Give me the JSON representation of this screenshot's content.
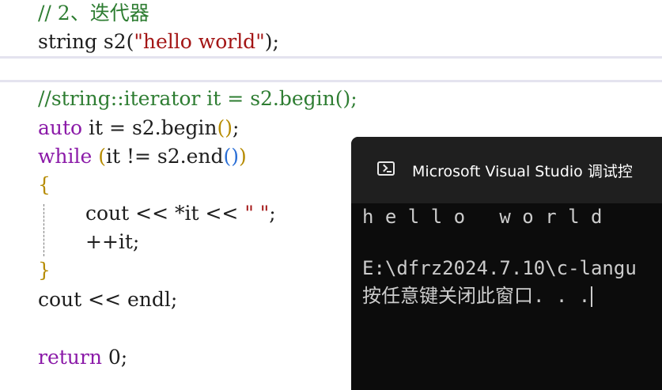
{
  "editor": {
    "line1_comment": "// 2、迭代器",
    "line2": {
      "type": "string",
      "var": "s2",
      "open": "(",
      "literal": "\"hello world\"",
      "close": ");"
    },
    "line3_comment": "//string::iterator it = s2.begin();",
    "line4": {
      "kw": "auto",
      "rest": " it = s2.begin",
      "parens": "()",
      "end": ";"
    },
    "line5": {
      "kw": "while",
      "open": " (",
      "mid": "it != s2.end",
      "inner": "()",
      "close": ")"
    },
    "brace_open": "{",
    "line7": {
      "pre": "cout << *it << ",
      "literal": "\" \"",
      "end": ";"
    },
    "line8": "++it;",
    "brace_close": "}",
    "line10": "cout << endl;",
    "line12": {
      "kw": "return",
      "rest": " 0;"
    }
  },
  "console": {
    "title": "Microsoft Visual Studio 调试控",
    "close_symbol": "×",
    "output_line": "h e l l o   w o r l d",
    "path_line": "E:\\dfrz2024.7.10\\c-langu",
    "prompt_line": "按任意键关闭此窗口. . ."
  },
  "colors": {
    "comment": "#2e7d32",
    "keyword": "#8b1aa8",
    "string": "#a31515",
    "console_bg": "#0c0c0c",
    "console_title_bg": "#1f1f1f"
  },
  "icons": [
    "terminal-icon",
    "close-icon"
  ]
}
